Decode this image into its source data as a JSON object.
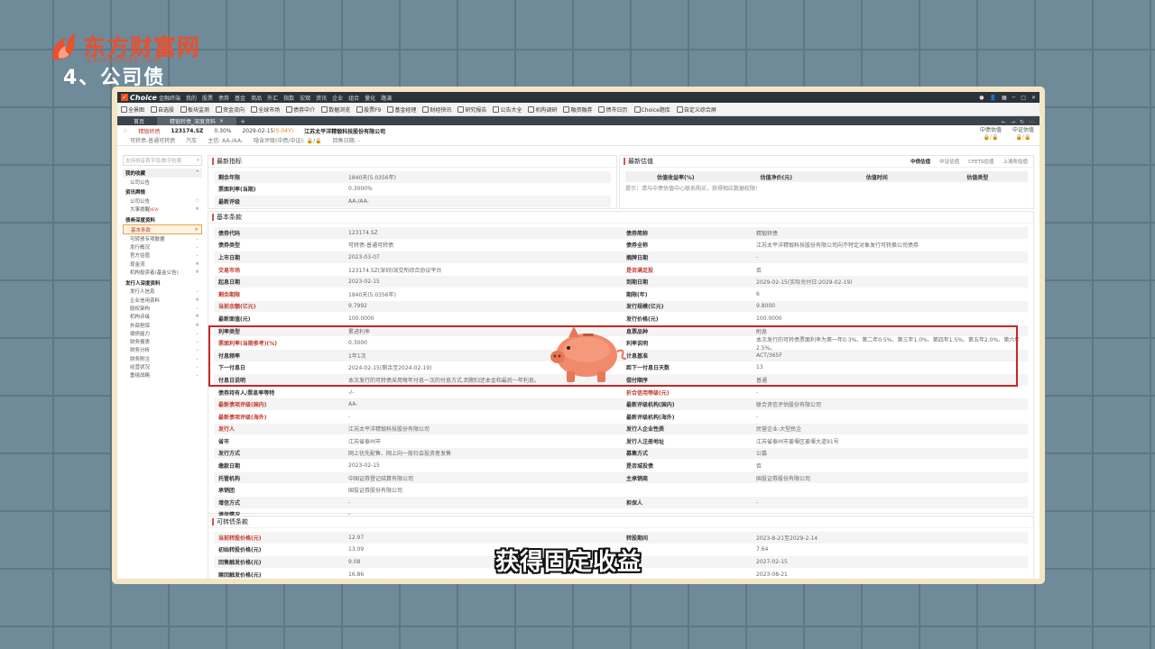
{
  "overlay": {
    "logo_text": "东方财富网",
    "logo_url": "eastmoney.com",
    "section_title": "4、公司债",
    "subtitle": "获得固定收益"
  },
  "app": {
    "brand": "Choice",
    "brand_sub": "金融终端",
    "menu": [
      "我的",
      "股票",
      "债券",
      "基金",
      "商品",
      "外汇",
      "指数",
      "宏观",
      "资讯",
      "企业",
      "组合",
      "量化",
      "路演"
    ],
    "toolbar": [
      "全景图",
      "自选股",
      "板块监测",
      "资金流向",
      "全球市场",
      "债券中介",
      "数据浏览",
      "股票F9",
      "基金经理",
      "财经快讯",
      "研究报告",
      "公告大全",
      "机构调研",
      "融资融券",
      "债市日历",
      "Choice题库",
      "自定义综合屏"
    ],
    "tabs": [
      {
        "label": "首页"
      },
      {
        "label": "精锻转债_深度资料"
      }
    ],
    "tab_add": "+"
  },
  "security": {
    "name": "精锻转债",
    "code": "123174.SZ",
    "change": "0.30%",
    "date": "2029-02-15",
    "date_suffix": "(5.04Y)",
    "company": "江苏太平洋精锻科技股份有限公司",
    "line2": [
      "可转债-普通可转债",
      "汽车",
      "主信: AA-/AA-",
      "隐含评级(中债/中证): 🔒/🔒",
      "回售日期: -"
    ],
    "right": [
      {
        "label": "中债估值",
        "value": "🔒/🔒"
      },
      {
        "label": "中证估值",
        "value": "🔒/🔒"
      }
    ]
  },
  "sidebar": {
    "search_placeholder": "支持拼音首字母/数字检索",
    "group_label": "我的收藏",
    "sections": [
      {
        "title": null,
        "items": [
          {
            "label": "公司公告",
            "side": ""
          }
        ]
      },
      {
        "title": "资讯舆情",
        "items": [
          {
            "label": "公司公告",
            "side": "☆",
            "star": true
          },
          {
            "label": "大事提醒",
            "side": "★",
            "new": "NEW"
          }
        ]
      },
      {
        "title": "债券深度资料",
        "items": [
          {
            "label": "基本条款",
            "side": "★",
            "selected": true
          },
          {
            "label": "可转债专项数据",
            "side": "⌄"
          },
          {
            "label": "发行概况",
            "side": "⌄"
          },
          {
            "label": "官方估值",
            "side": "⌄"
          },
          {
            "label": "现金流",
            "side": "★"
          },
          {
            "label": "机构投资者(基金公告)",
            "side": "★"
          }
        ]
      },
      {
        "title": "发行人深度资料",
        "items": [
          {
            "label": "发行人信息",
            "side": "⌄"
          },
          {
            "label": "企业信用资料",
            "side": "★"
          },
          {
            "label": "股权架构",
            "side": "⌄"
          },
          {
            "label": "机构评级",
            "side": "★"
          },
          {
            "label": "外部担保",
            "side": "★"
          },
          {
            "label": "偿债能力",
            "side": "⌄"
          },
          {
            "label": "财务报表",
            "side": "⌄"
          },
          {
            "label": "财务分析",
            "side": "⌄"
          },
          {
            "label": "财务附注",
            "side": "⌄"
          },
          {
            "label": "经营状况",
            "side": "⌄"
          },
          {
            "label": "重组战略",
            "side": "⌄"
          }
        ]
      }
    ]
  },
  "latest_indicators": {
    "title": "最新指标",
    "rows": [
      {
        "k": "剩余年限",
        "v": "1840天(5.0356年)"
      },
      {
        "k": "票面利率(当期)",
        "v": "0.3000%"
      },
      {
        "k": "最新评级",
        "v": "AA-/AA-"
      }
    ]
  },
  "latest_estimate": {
    "title": "最新估值",
    "tabs": [
      "中债估值",
      "中证估值",
      "CFETS估值",
      "上清所估值"
    ],
    "headers": [
      "估值收益率(%)",
      "估值净价(元)",
      "估值时间",
      "估值类型"
    ],
    "note": "提示：请与中债估值中心联系购买，获得相应数据权限!"
  },
  "basic_terms": {
    "title": "基本条款",
    "left": [
      {
        "k": "债券代码",
        "v": "123174.SZ"
      },
      {
        "k": "债券类型",
        "v": "可转债-普通可转债"
      },
      {
        "k": "上市日期",
        "v": "2023-03-07"
      },
      {
        "k": "交易市场",
        "v": "123174.SZ(深圳)深交所综合协议平台",
        "red": true
      },
      {
        "k": "起息日期",
        "v": "2023-02-15"
      },
      {
        "k": "剩余期限",
        "v": "1840天(5.0356年)",
        "red": true
      },
      {
        "k": "当前余额(亿元)",
        "v": "9.7992",
        "red": true
      },
      {
        "k": "最新面值(元)",
        "v": "100.0000"
      },
      {
        "k": "利率类型",
        "v": "累进利率"
      },
      {
        "k": "票面利率(当期参考)(%)",
        "v": "0.3000",
        "red": true
      },
      {
        "k": "付息频率",
        "v": "1年1次"
      },
      {
        "k": "下一付息日",
        "v": "2024-02-15(剩余至2024-02-19)"
      },
      {
        "k": "付息日说明",
        "v": "本次发行的可转债采用每年付息一次的付息方式,到期归还本金和最后一年利息。"
      },
      {
        "k": "债券持有人/票息率等特",
        "v": "-/-"
      },
      {
        "k": "最新债项评级(国内)",
        "v": "AA-",
        "red": true
      },
      {
        "k": "最新债项评级(海外)",
        "v": "-",
        "red": true
      },
      {
        "k": "发行人",
        "v": "江苏太平洋精锻科技股份有限公司",
        "red": true
      },
      {
        "k": "省市",
        "v": "江苏省泰州市"
      },
      {
        "k": "发行方式",
        "v": "网上优先配售、网上向一般社会投资者发售"
      },
      {
        "k": "缴款日期",
        "v": "2023-02-15"
      },
      {
        "k": "托管机构",
        "v": "中国证券登记结算有限公司"
      },
      {
        "k": "承销团",
        "v": "国投证券股份有限公司"
      },
      {
        "k": "增信方式",
        "v": "-"
      },
      {
        "k": "增信情况",
        "v": "-"
      }
    ],
    "right": [
      {
        "k": "债券简称",
        "v": "精锻转债"
      },
      {
        "k": "债券全称",
        "v": "江苏太平洋精锻科技股份有限公司向不特定对象发行可转换公司债券"
      },
      {
        "k": "摘牌日期",
        "v": "-"
      },
      {
        "k": "是否满足投",
        "v": "否",
        "red": true
      },
      {
        "k": "到期日期",
        "v": "2029-02-15(实际兑付日:2029-02-19)"
      },
      {
        "k": "期限(年)",
        "v": "6"
      },
      {
        "k": "发行规模(亿元)",
        "v": "9.8000"
      },
      {
        "k": "发行价格(元)",
        "v": "100.0000"
      },
      {
        "k": "息票品种",
        "v": "附息"
      },
      {
        "k": "利率说明",
        "v": "本次发行的可转债票面利率为第一年0.3%、第二年0.5%、第三年1.0%、第四年1.5%、第五年2.0%、第六年2.5%。"
      },
      {
        "k": "计息基准",
        "v": "ACT/365F"
      },
      {
        "k": "距下一付息日天数",
        "v": "13"
      },
      {
        "k": "偿付顺序",
        "v": "普通"
      },
      {
        "k": "折合信用等级(元)",
        "v": "-",
        "red": true
      },
      {
        "k": "最新评级机构(国内)",
        "v": "联合资信评估股份有限公司"
      },
      {
        "k": "最新评级机构(海外)",
        "v": "-"
      },
      {
        "k": "发行人企业性质",
        "v": "民营企业-大型民企"
      },
      {
        "k": "发行人注册地址",
        "v": "江苏省泰州市姜堰区姜堰大道91号"
      },
      {
        "k": "募集方式",
        "v": "公募"
      },
      {
        "k": "是否城投债",
        "v": "否"
      },
      {
        "k": "主承销商",
        "v": "国投证券股份有限公司"
      },
      {
        "k": "",
        "v": ""
      },
      {
        "k": "担保人",
        "v": "-"
      },
      {
        "k": "",
        "v": ""
      }
    ]
  },
  "convertible_terms": {
    "title": "可转债条款",
    "left": [
      {
        "k": "当前转股价格(元)",
        "v": "12.97",
        "red": true
      },
      {
        "k": "初始转股价格(元)",
        "v": "13.09"
      },
      {
        "k": "回售触发价格(元)",
        "v": "9.08"
      },
      {
        "k": "赎回触发价格(元)",
        "v": "16.86"
      }
    ],
    "right": [
      {
        "k": "转股期间",
        "v": "2023-8-21至2029-2-14"
      },
      {
        "k": "",
        "v": "7.64"
      },
      {
        "k": "",
        "v": "2027-02-15"
      },
      {
        "k": "",
        "v": "2023-08-21"
      }
    ]
  },
  "colors": {
    "accent_red": "#c62828",
    "brand_orange": "#e8502e",
    "frame": "#f4e6c4",
    "background": "#6f8a99"
  }
}
